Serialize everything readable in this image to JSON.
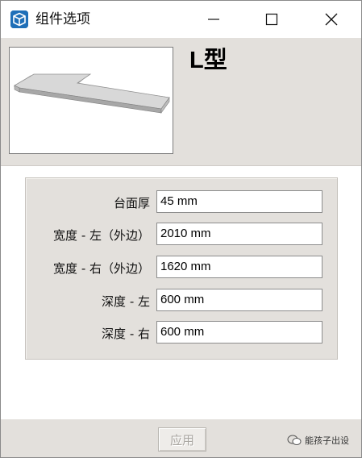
{
  "window": {
    "title": "组件选项",
    "app_icon": "sketchup-icon",
    "controls": [
      "minimize-icon",
      "maximize-icon",
      "close-icon"
    ]
  },
  "header": {
    "component_name": "L型",
    "preview_icon": "l-shaped-countertop-preview"
  },
  "form": {
    "fields": [
      {
        "label": "台面厚",
        "value": "45 mm"
      },
      {
        "label": "宽度 - 左（外边）",
        "value": "2010 mm"
      },
      {
        "label": "宽度 - 右（外边）",
        "value": "1620 mm"
      },
      {
        "label": "深度 - 左",
        "value": "600 mm"
      },
      {
        "label": "深度 - 右",
        "value": "600 mm"
      }
    ]
  },
  "footer": {
    "apply_label": "应用",
    "apply_enabled": false,
    "watermark_text": "能孩子出设"
  },
  "colors": {
    "panel_bg": "#e3e0dc",
    "title_bg": "#ffffff",
    "disabled_text": "#a9a6a1"
  }
}
